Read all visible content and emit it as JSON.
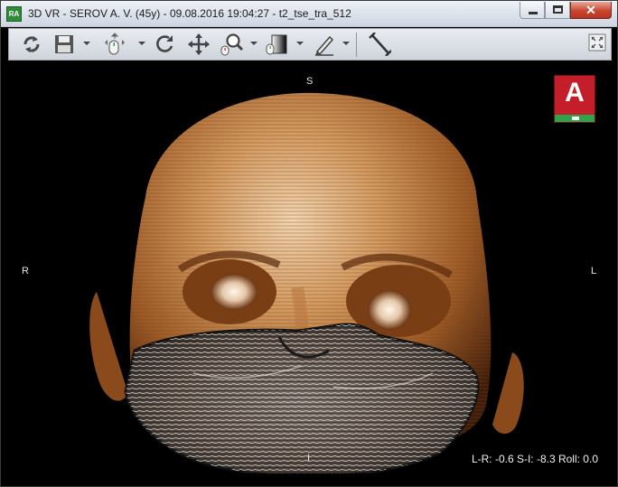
{
  "window": {
    "app_icon_text": "RA",
    "title": "3D VR - SEROV A. V. (45y) - 09.08.2016 19:04:27 - t2_tse_tra_512",
    "close_glyph": "✕"
  },
  "toolbar": {
    "tools": [
      "refresh-icon",
      "save-icon",
      "pan-mouse-icon",
      "rotate-icon",
      "move-icon",
      "zoom-icon",
      "window-level-icon",
      "pen-icon",
      "ruler-icon",
      "fullscreen-icon"
    ]
  },
  "viewport": {
    "orientation": {
      "top": "S",
      "left": "R",
      "right": "L",
      "bottom": "I"
    },
    "view_badge": "A",
    "readout": "L-R: -0.6 S-I: -8.3 Roll: 0.0"
  },
  "colors": {
    "badge_red": "#c41e2a",
    "badge_green": "#2fa34a",
    "skin": "#c98a52",
    "background": "#000000"
  }
}
